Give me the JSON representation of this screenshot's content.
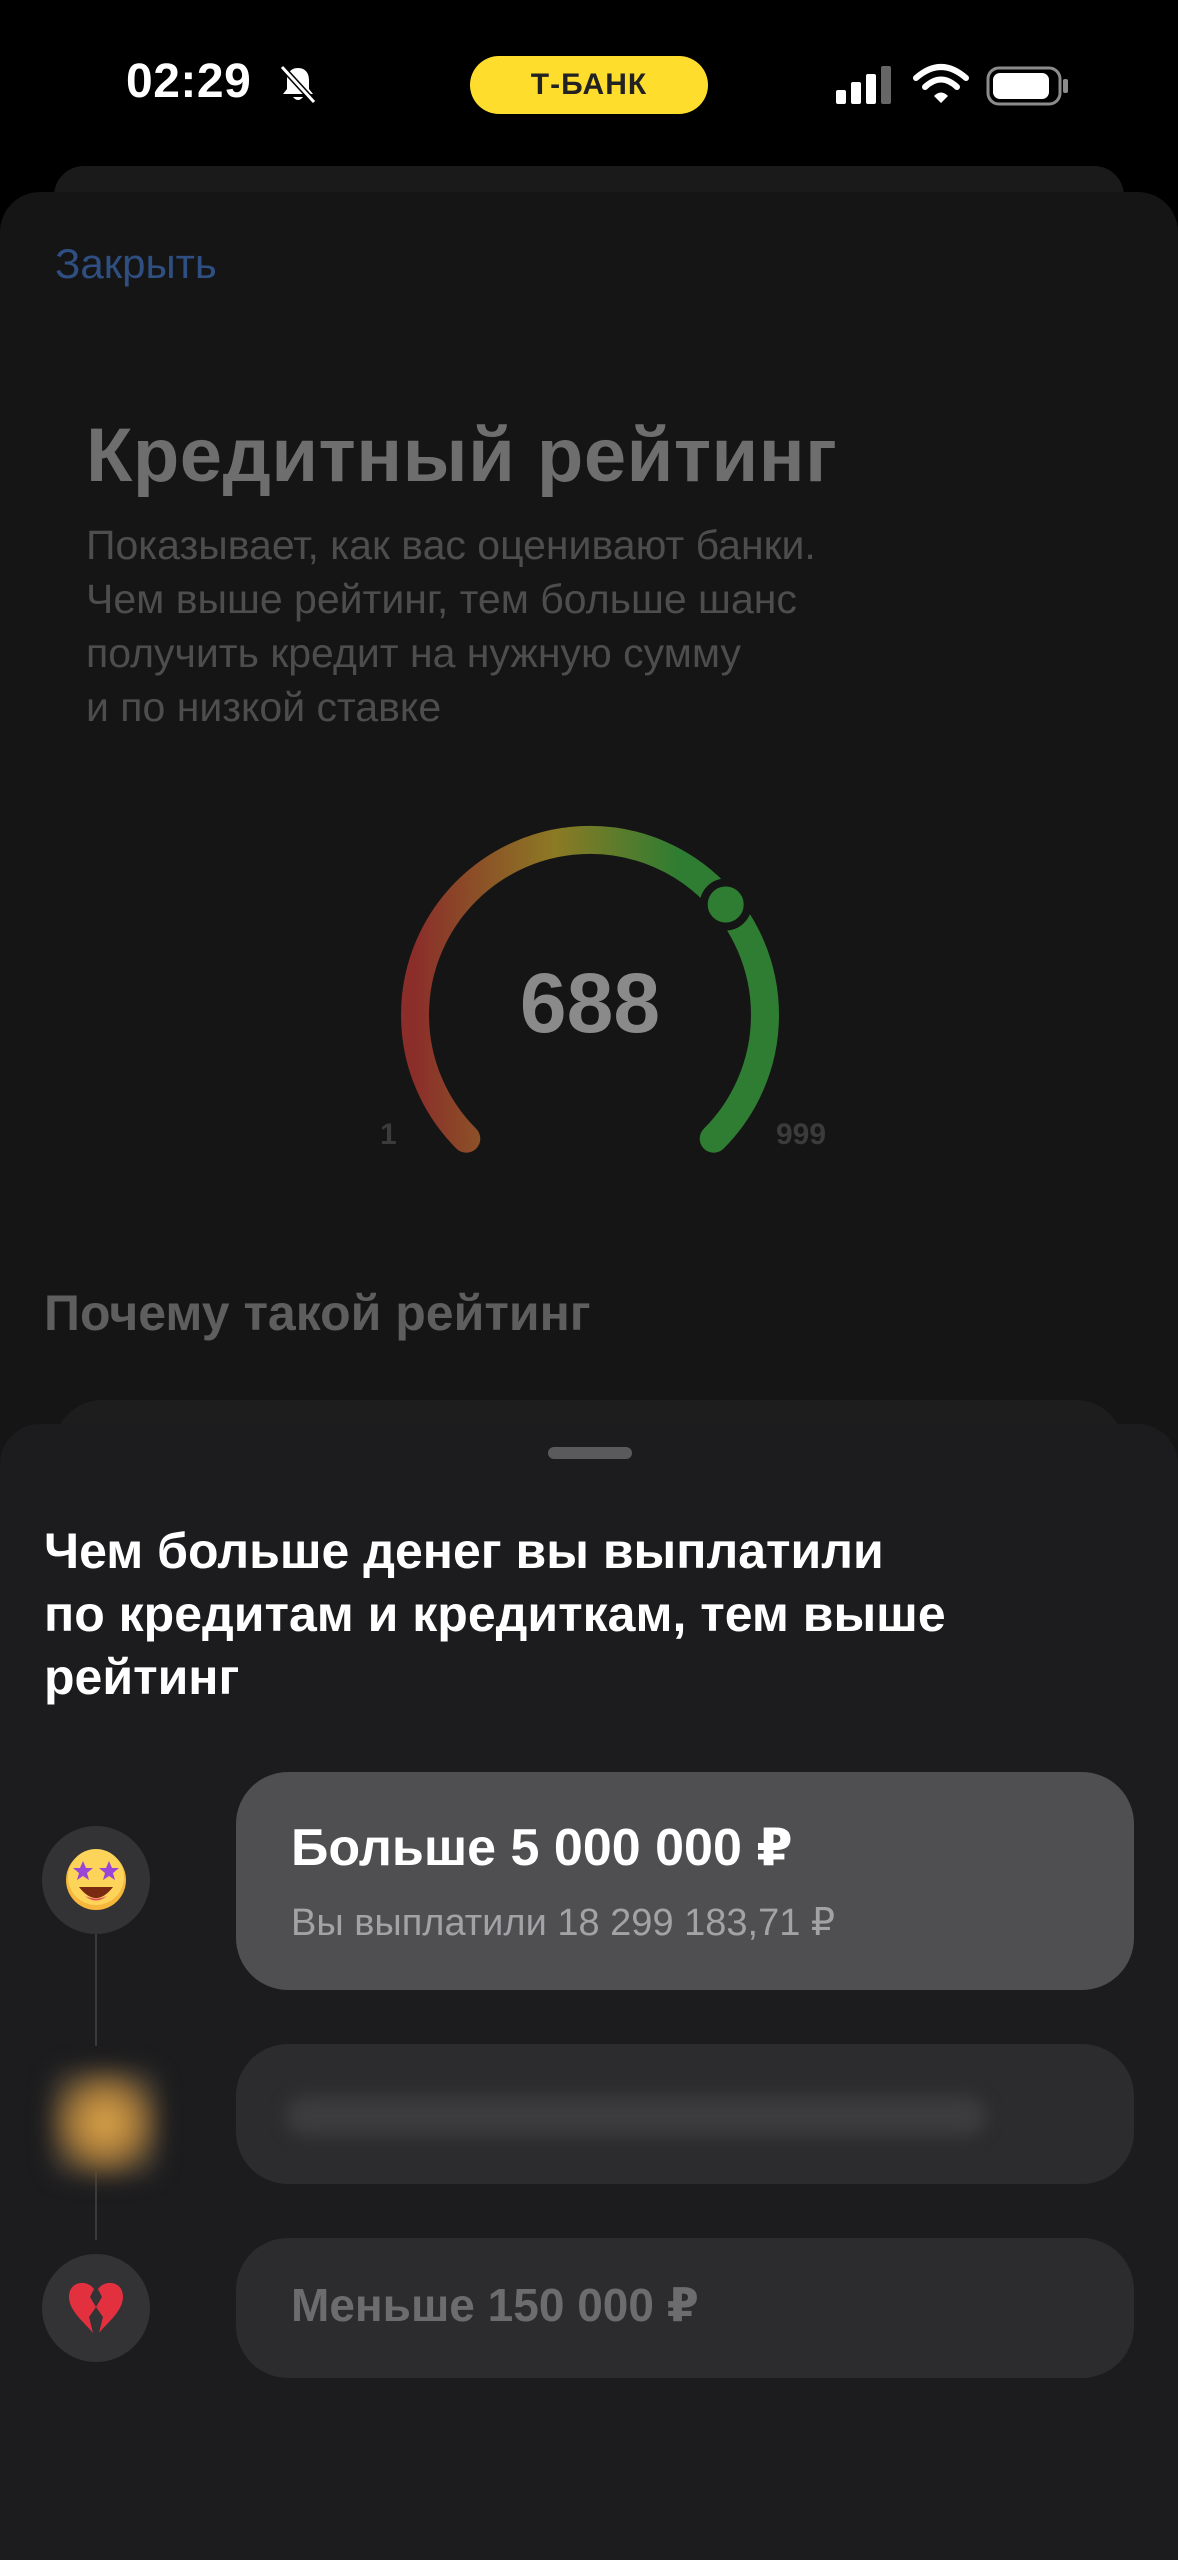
{
  "status_bar": {
    "time": "02:29",
    "carrier_badge": "Т-БАНК",
    "icons": [
      "bell-off-icon",
      "signal-icon",
      "wifi-icon",
      "battery-icon"
    ],
    "accent": "#ffdd2d"
  },
  "background_screen": {
    "close_label": "Закрыть",
    "title": "Кредитный рейтинг",
    "subtitle_lines": [
      "Показывает, как вас оценивают банки.",
      "Чем выше рейтинг, тем больше шанс",
      "получить кредит на нужную сумму",
      "и по низкой ставке"
    ],
    "gauge": {
      "score": "688",
      "min_label": "1",
      "max_label": "999",
      "value": 688,
      "min": 1,
      "max": 999,
      "colors": [
        "#8b2e2a",
        "#8c7a24",
        "#2f7d32"
      ]
    },
    "section_title": "Почему такой рейтинг"
  },
  "sheet": {
    "title_lines": [
      "Чем больше денег вы выплатили",
      "по кредитам и кредиткам, тем выше",
      "рейтинг"
    ],
    "tiers": [
      {
        "icon": "star-struck-emoji-icon",
        "emoji": "🤩",
        "title": "Больше 5 000 000 ₽",
        "subtitle": "Вы выплатили 18 299 183,71 ₽",
        "active": true
      },
      {
        "icon": "blurred-emoji-icon",
        "title": "",
        "subtitle": "",
        "active": false
      },
      {
        "icon": "broken-heart-emoji-icon",
        "emoji": "💔",
        "title": "Меньше 150 000 ₽",
        "subtitle": "",
        "active": false
      }
    ]
  }
}
